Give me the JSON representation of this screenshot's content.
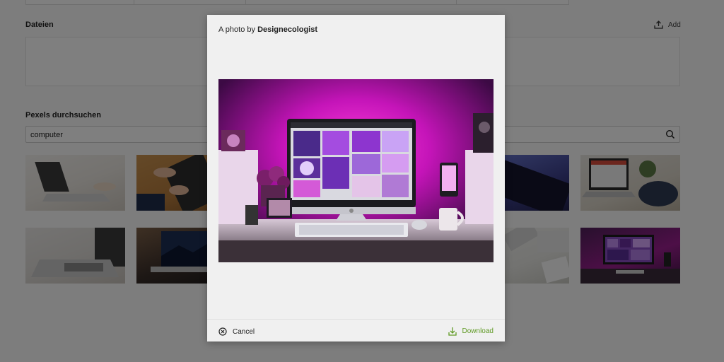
{
  "files": {
    "title": "Dateien",
    "add_label": "Add"
  },
  "pexels": {
    "title": "Pexels durchsuchen",
    "search_value": "computer"
  },
  "results": [
    {
      "icon": "laptop-photo"
    },
    {
      "icon": "keyboard-photo"
    },
    {
      "icon": "keyboard-dark-photo"
    },
    {
      "icon": "laptop-desk-photo"
    },
    {
      "icon": "macbook-photo"
    },
    {
      "icon": "laptop-night-photo"
    },
    {
      "icon": "keyboard-white-photo"
    },
    {
      "icon": "pink-desk-photo"
    }
  ],
  "modal": {
    "title_prefix": "A photo by",
    "author": "Designecologist",
    "cancel_label": "Cancel",
    "download_label": "Download"
  },
  "colors": {
    "accent": "#5f9a24",
    "overlay": "rgba(0,0,0,0.5)"
  }
}
